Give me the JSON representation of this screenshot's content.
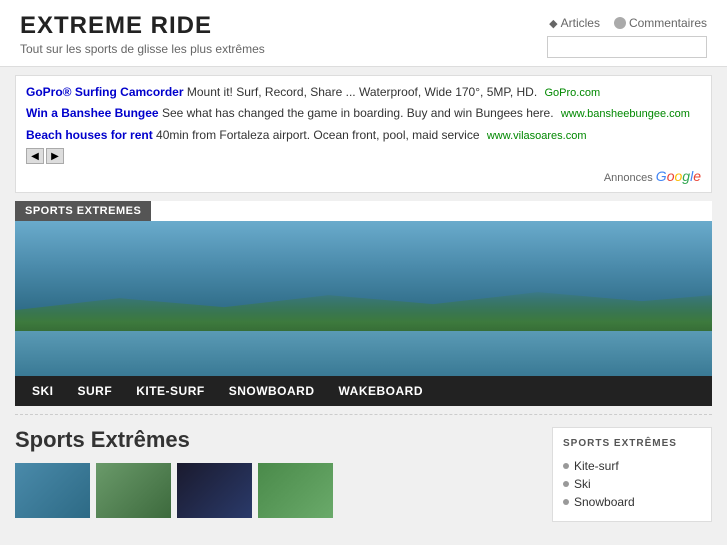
{
  "site": {
    "title": "EXTREME RIDE",
    "subtitle": "Tout sur les sports de glisse les plus extrêmes"
  },
  "header": {
    "articles_label": "Articles",
    "commentaires_label": "Commentaires",
    "search_placeholder": ""
  },
  "ads": {
    "items": [
      {
        "title": "GoPro® Surfing Camcorder",
        "description": "Mount it! Surf, Record, Share ... Waterproof, Wide 170°, 5MP, HD.",
        "url": "GoPro.com"
      },
      {
        "title": "Win a Banshee Bungee",
        "description": "See what has changed the game in boarding. Buy and win Bungees here.",
        "url": "www.bansheebungee.com"
      },
      {
        "title": "Beach houses for rent",
        "description": "40min from Fortaleza airport. Ocean front, pool, maid service",
        "url": "www.vilasoares.com"
      }
    ],
    "footer": "Annonces Google"
  },
  "sports_tab": "SPORTS EXTREMES",
  "nav": {
    "items": [
      "SKI",
      "SURF",
      "KITE-SURF",
      "SNOWBOARD",
      "WAKEBOARD"
    ]
  },
  "main": {
    "title": "Sports Extrêmes"
  },
  "sidebar": {
    "title": "SPORTS EXTRÊMES",
    "items": [
      "Kite-surf",
      "Ski",
      "Snowboard"
    ]
  }
}
